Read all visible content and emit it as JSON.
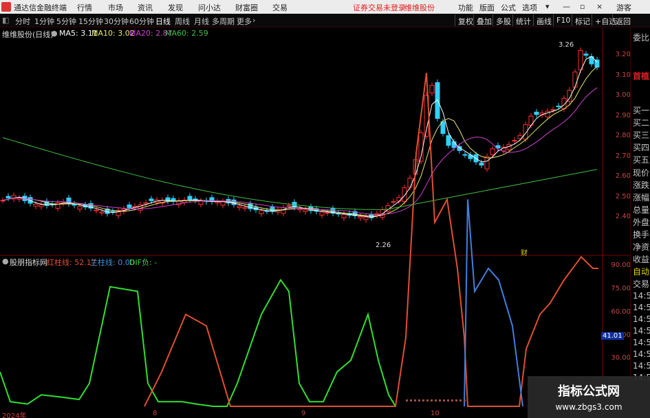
{
  "app": {
    "title": "通达信金融终端",
    "menu": [
      "行情",
      "市场",
      "资讯",
      "发现",
      "问小达",
      "财富圈",
      "交易"
    ],
    "status_red": "证券交易未登录",
    "stock_name_top": "维维股份",
    "right_menu": [
      "功能",
      "版面",
      "公式",
      "选项"
    ],
    "guest": "游客"
  },
  "periods": [
    "分时",
    "1分钟",
    "5分钟",
    "15分钟",
    "30分钟",
    "60分钟",
    "日线",
    "周线",
    "月线",
    "多周期",
    "更多"
  ],
  "active_period": "日线",
  "toolbar_right": [
    "复权",
    "叠加",
    "多股",
    "统计",
    "画线",
    "F10",
    "标记",
    "+自选",
    "返回"
  ],
  "main_chart": {
    "title": "维维股份(日线)",
    "ma5_label": "MA5: 3.11",
    "ma10_label": "MA10: 3.02",
    "ma20_label": "MA20: 2.87",
    "ma60_label": "MA60: 2.59",
    "y_ticks": [
      "3.20",
      "3.10",
      "3.00",
      "2.90",
      "2.80",
      "2.70",
      "2.60",
      "2.50",
      "2.40"
    ],
    "high_label": "3.26",
    "low_label": "2.26",
    "marker": "财",
    "colors": {
      "ma5": "#ffffff",
      "ma10": "#e8e870",
      "ma20": "#d040d0",
      "ma60": "#40c040",
      "up": "#ff3030",
      "down": "#30d0ff"
    }
  },
  "sub_chart": {
    "title": "股朋指标网",
    "red_label": "红柱线: 52.17",
    "blue_label": "兰柱线: 0.00",
    "dif_label": "DIF负: -",
    "y_ticks": [
      "90.00",
      "75.00",
      "60.00",
      "45.00",
      "30.00"
    ],
    "current": "41.01"
  },
  "x_labels": [
    "2024年",
    "8",
    "9",
    "10"
  ],
  "right_panel": [
    "委比",
    "首植",
    "买一",
    "买二",
    "买三",
    "买四",
    "买五",
    "现价",
    "涨跌",
    "涨幅",
    "总量",
    "外盘",
    "换手",
    "净资",
    "收益",
    "自动",
    "交易",
    "14:56",
    "14:56",
    "14:56",
    "14:56",
    "14:56",
    "14:56",
    "14:56",
    "14:56"
  ],
  "watermark": {
    "line1": "指标公式网",
    "line2": "www.zbgs3.com"
  }
}
